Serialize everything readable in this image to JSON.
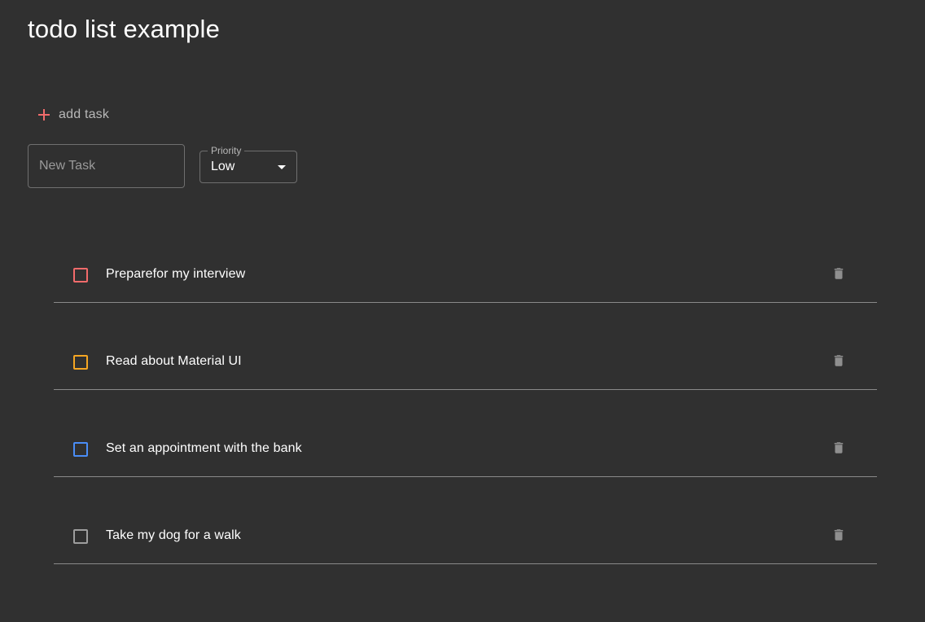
{
  "page": {
    "title": "todo list example"
  },
  "toolbar": {
    "add_task_label": "add task",
    "add_icon": "plus-icon",
    "add_icon_color": "#f26b6b"
  },
  "new_task": {
    "placeholder": "New Task",
    "value": ""
  },
  "priority": {
    "label": "Priority",
    "selected": "Low"
  },
  "tasks": [
    {
      "text": "Preparefor my interview",
      "priority_color": "#f26b6b",
      "checked": false,
      "delete_icon": "trash-icon"
    },
    {
      "text": "Read about Material UI",
      "priority_color": "#f5a623",
      "checked": false,
      "delete_icon": "trash-icon"
    },
    {
      "text": "Set an appointment with the bank",
      "priority_color": "#4a8df6",
      "checked": false,
      "delete_icon": "trash-icon"
    },
    {
      "text": "Take my dog for a walk",
      "priority_color": "#9e9e9e",
      "checked": false,
      "delete_icon": "trash-icon"
    }
  ],
  "colors": {
    "background": "#303030",
    "text": "#ffffff",
    "muted_text": "#b8b8b8",
    "divider": "#8a8a8a",
    "icon": "#8f8f8f"
  }
}
